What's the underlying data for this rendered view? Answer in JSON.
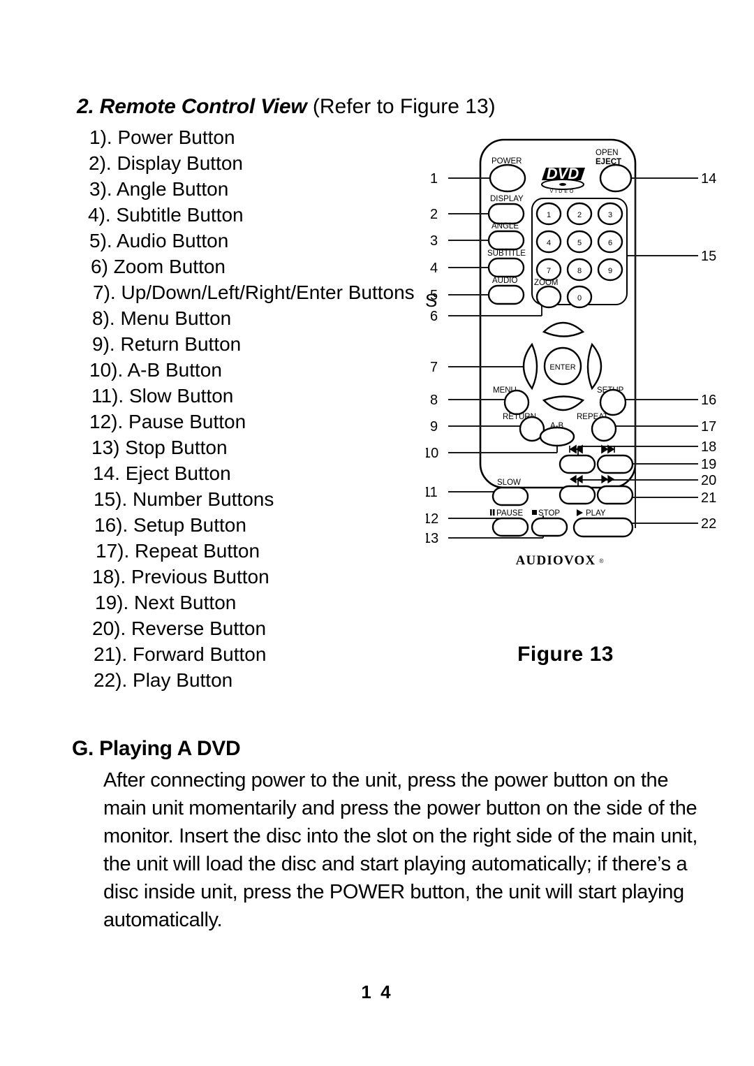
{
  "section": {
    "heading_bold": "2. Remote Control View",
    "heading_plain": " (Refer to Figure 13)"
  },
  "button_list": [
    {
      "n": "1).",
      "label": "Power Button"
    },
    {
      "n": "2).",
      "label": "Display Button"
    },
    {
      "n": "3).",
      "label": " Angle Button"
    },
    {
      "n": "4).",
      "label": "Subtitle Button"
    },
    {
      "n": "5).",
      "label": "Audio Button"
    },
    {
      "n": "6)",
      "label": "Zoom Button"
    },
    {
      "n": "7).",
      "label": "Up/Down/Left/Right/Enter Buttons"
    },
    {
      "n": "8).",
      "label": "Menu Button"
    },
    {
      "n": "9).",
      "label": "Return Button"
    },
    {
      "n": "10).",
      "label": "A-B Button"
    },
    {
      "n": "11).",
      "label": "Slow Button"
    },
    {
      "n": "12).",
      "label": "Pause Button"
    },
    {
      "n": "13)",
      "label": "Stop Button"
    },
    {
      "n": "14.",
      "label": "Eject Button"
    },
    {
      "n": "15).",
      "label": "Number Buttons"
    },
    {
      "n": "16).",
      "label": "Setup Button"
    },
    {
      "n": "17).",
      "label": "Repeat Button"
    },
    {
      "n": "18).",
      "label": "Previous Button"
    },
    {
      "n": "19).",
      "label": "Next Button"
    },
    {
      "n": "20).",
      "label": "Reverse Button"
    },
    {
      "n": "21).",
      "label": "Forward Button"
    },
    {
      "n": "22).",
      "label": "Play Button"
    }
  ],
  "figure": {
    "caption": "Figure 13",
    "brand": "AUDIOVOX",
    "brand_mark": "®",
    "disc_logo_top": "DVD",
    "disc_logo_bottom": "VIDEO",
    "buttons": {
      "power": "POWER",
      "open": "OPEN",
      "eject": "EJECT",
      "display": "DISPLAY",
      "angle": "ANGLE",
      "subtitle": "SUBTITLE",
      "audio": "AUDIO",
      "zoom": "ZOOM",
      "enter": "ENTER",
      "menu": "MENU",
      "setup": "SETUP",
      "return": "RETURN",
      "repeat": "REPEAT",
      "ab": "A-B",
      "slow": "SLOW",
      "pause": "PAUSE",
      "stop": "STOP",
      "play": "PLAY"
    },
    "keypad": [
      "1",
      "2",
      "3",
      "4",
      "5",
      "6",
      "7",
      "8",
      "9",
      "0"
    ],
    "callouts_left": [
      "1",
      "2",
      "3",
      "4",
      "5",
      "6",
      "7",
      "8",
      "9",
      "10",
      "11",
      "12",
      "13"
    ],
    "callouts_right": [
      "14",
      "15",
      "16",
      "17",
      "18",
      "19",
      "20",
      "21",
      "22"
    ],
    "stray_glyph": "S"
  },
  "playing": {
    "heading": "G. Playing A DVD",
    "body": "After connecting power to the unit, press the power button on the main unit momentarily and press the power button on the side of the monitor. Insert the disc into the slot on the right side of the main unit, the unit will load the disc and start playing automatically; if there’s a disc inside unit, press the POWER button, the unit will start playing automatically."
  },
  "page_number": "1 4",
  "colors": {
    "ink": "#000000",
    "paper": "#ffffff",
    "leader": "#1a1a1a"
  }
}
